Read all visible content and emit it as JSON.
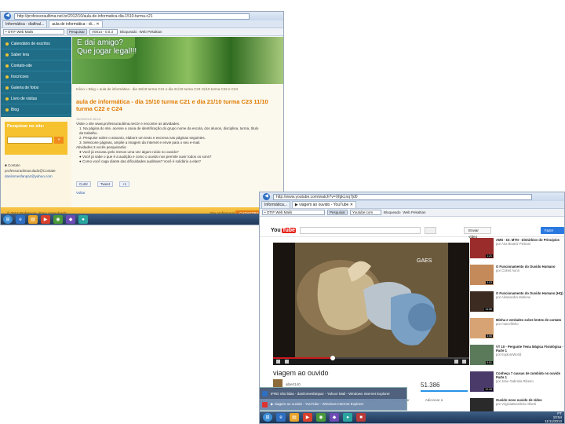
{
  "screenshot1": {
    "address": "http://professoraultima.net.br/2012/10/aula-de-informatica-dia-1510-turma-c21",
    "tabs": [
      "Informática - diafinal...",
      "aula de informática - di...  ✕"
    ],
    "toolbar": {
      "search_value": "• OTIF Web Mails",
      "search_button": "Pesquisar",
      "item2": "V0014 - 0.0.3",
      "item3": "Bloqueado",
      "item4": "Web Pekaltian"
    },
    "nav": [
      "Calendário de escritos",
      "Saber lera",
      "Contato-site",
      "Inscricoes",
      "Galeria de fotos",
      "Livro de visitas",
      "Blog"
    ],
    "search_title": "Pesquisar no site:",
    "search_button": "»",
    "contact": [
      "■ Contato",
      "professoradimaculado@Contate",
      "danilomesfanpaz@yahoo.com"
    ],
    "hero_text": [
      "E daí amigo?",
      "Que jogar legal!!!"
    ],
    "breadcrumb": "Início » Blog » aula de informática - dia 15/10 turma C21 e dia 21/10 turma C23 11/10 turma C22 e C24",
    "post_title": "aula de informática - dia 15/10 turma C21 e dia 21/10 turma C23 11/10 turma C22 e C24",
    "post_date": "15/10/2012 08:13",
    "post_body": [
      "Visite o site www.professoraultima.net.br e encontre as atividades.",
      "1. Na página do site, acesse a caixa de identificação do grupo nome da escola, dos alunos, disciplina, turma, título",
      "   da trabalho.",
      "2. Pesquise sobre o assunto, elabore um texto e escreva nas páginas seguintes.",
      "3. Selecione páginas, amplie a imagem da Internet e envie para o seu e-mail.",
      "Atividades 3 vocês pesquisarão:",
      "● Você já escutou pelo menos uma vez algum ruído no ouvido?",
      "● Você já sabe o que é a audição e como o ouvido nos permite ouvir todos os sons?",
      "● Como você caga diante das dificuldades auditivas? Você é solidário a elas?"
    ],
    "actions": [
      "Curtir",
      "Tweet",
      "+1"
    ],
    "replies": "Voltar",
    "footer_left": "© 2012 Professora ultima aprendendo",
    "footer_right": "Site profissional",
    "footer_btn": "CADASTRAR",
    "tray": [
      "PT",
      "17:14",
      "17/11/2012"
    ]
  },
  "screenshot2": {
    "address": "http://www.youtube.com/watch?v=XfgkLnq7jd0",
    "tabs": [
      "Informática...",
      "▶ viagem ao ouvido - YouTube  ✕"
    ],
    "toolbar": {
      "search_value": "• OTIF Web Mails",
      "search_button": "Pesquisar",
      "item2": "Youtube.com",
      "item3": "Bloqueado",
      "item4": "Web Pekaltian"
    },
    "yt_logo": [
      "You",
      "Tube"
    ],
    "upload_label": "Enviar vídeo",
    "login_label": "Fazer login",
    "video_title": "viagem ao ouvido",
    "channel": "albert140",
    "views": "51.386",
    "actions": [
      "Gostei",
      "Sobre",
      "Compartilhar",
      "Adicionar a"
    ],
    "related": [
      {
        "title": "AMS - Dr. MTN - Distúrbios do Princípios",
        "meta": "por Ana Beatriz Pietrani",
        "dur": "1:21"
      },
      {
        "title": "O Funcionamento do Ouvido Humano",
        "meta": "por Colnet Aunn",
        "dur": "3:03"
      },
      {
        "title": "O Funcionamento do Ouvido Humano (HQ)",
        "meta": "por Alessandra Marlene",
        "dur": "14:56"
      },
      {
        "title": "Minha e verdades sobre lentes de contato",
        "meta": "por marcellinho",
        "dur": "4:06"
      },
      {
        "title": "VT 10 - Pergunte Tema Mágica Fisiológica - Parte 1",
        "meta": "por ExploreWorld",
        "dur": "5:51"
      },
      {
        "title": "Conheça 7 causas de zumbido no ouvido Parte 1",
        "meta": "por Jane Gabriela Ribeiro",
        "dur": "12:34"
      },
      {
        "title": "Ouvido novo ouvido de vídeo",
        "meta": "por VirginiaBrasileira Alberti",
        "dur": "8:34"
      }
    ],
    "popup": [
      "IFRD não lidas - danilomesfanpaz - Yahoo! Mail - Windows Internet Explorer",
      "▶ viagem ao ouvido - YouTube - Windows Internet Explorer"
    ],
    "tray": [
      "PT",
      "10:54",
      "11/11/2013"
    ]
  }
}
